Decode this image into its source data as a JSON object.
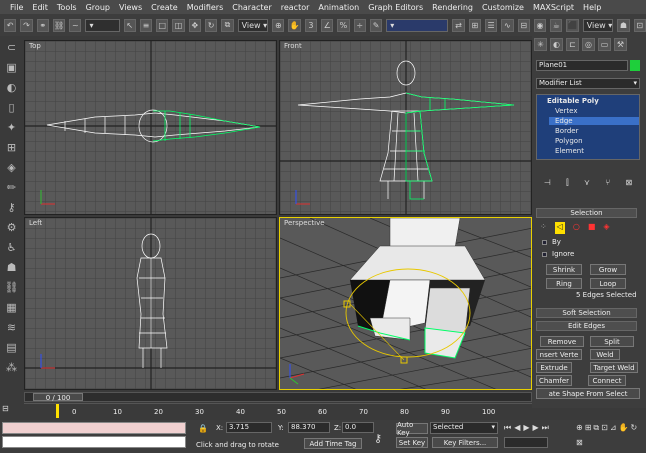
{
  "menu": [
    "File",
    "Edit",
    "Tools",
    "Group",
    "Views",
    "Create",
    "Modifiers",
    "Character",
    "reactor",
    "Animation",
    "Graph Editors",
    "Rendering",
    "Customize",
    "MAXScript",
    "Help"
  ],
  "toolbar": {
    "view_dropdown": "View",
    "view_dropdown2": "View"
  },
  "viewports": {
    "top": "Top",
    "front": "Front",
    "left": "Left",
    "perspective": "Perspective"
  },
  "panel": {
    "object_name": "Plane01",
    "modifier_list": "Modifier List",
    "stack": [
      "Editable Poly",
      "Vertex",
      "Edge",
      "Border",
      "Polygon",
      "Element"
    ],
    "selection": {
      "title": "Selection",
      "by_label": "By",
      "ignore_label": "Ignore",
      "shrink": "Shrink",
      "grow": "Grow",
      "ring": "Ring",
      "loop": "Loop",
      "status": "5 Edges Selected"
    },
    "soft_selection": "Soft Selection",
    "edit_edges": "Edit Edges",
    "remove": "Remove",
    "split": "Split",
    "insert_vertex": "nsert Verte",
    "weld": "Weld",
    "extrude": "Extrude",
    "target_weld": "Target Weld",
    "chamfer": "Chamfer",
    "connect": "Connect",
    "create_shape": "ate Shape From Select"
  },
  "timeline": {
    "frame": "0 / 100",
    "ticks": [
      "0",
      "10",
      "20",
      "30",
      "40",
      "50",
      "60",
      "70",
      "80",
      "90",
      "100"
    ]
  },
  "status": {
    "x_label": "X:",
    "x_value": "3.715",
    "y_label": "Y:",
    "y_value": "88.370",
    "z_label": "Z:",
    "z_value": "0.0",
    "prompt": "Click and drag to rotate",
    "add_time_tag": "Add Time Tag",
    "auto_key": "Auto Key",
    "selected": "Selected",
    "set_key": "Set Key",
    "key_filters": "Key Filters..."
  },
  "colors": {
    "viewport_bg": "#595959",
    "selected_edge": "#00ff66",
    "wire": "#ffffff",
    "highlight": "#ffe000"
  }
}
